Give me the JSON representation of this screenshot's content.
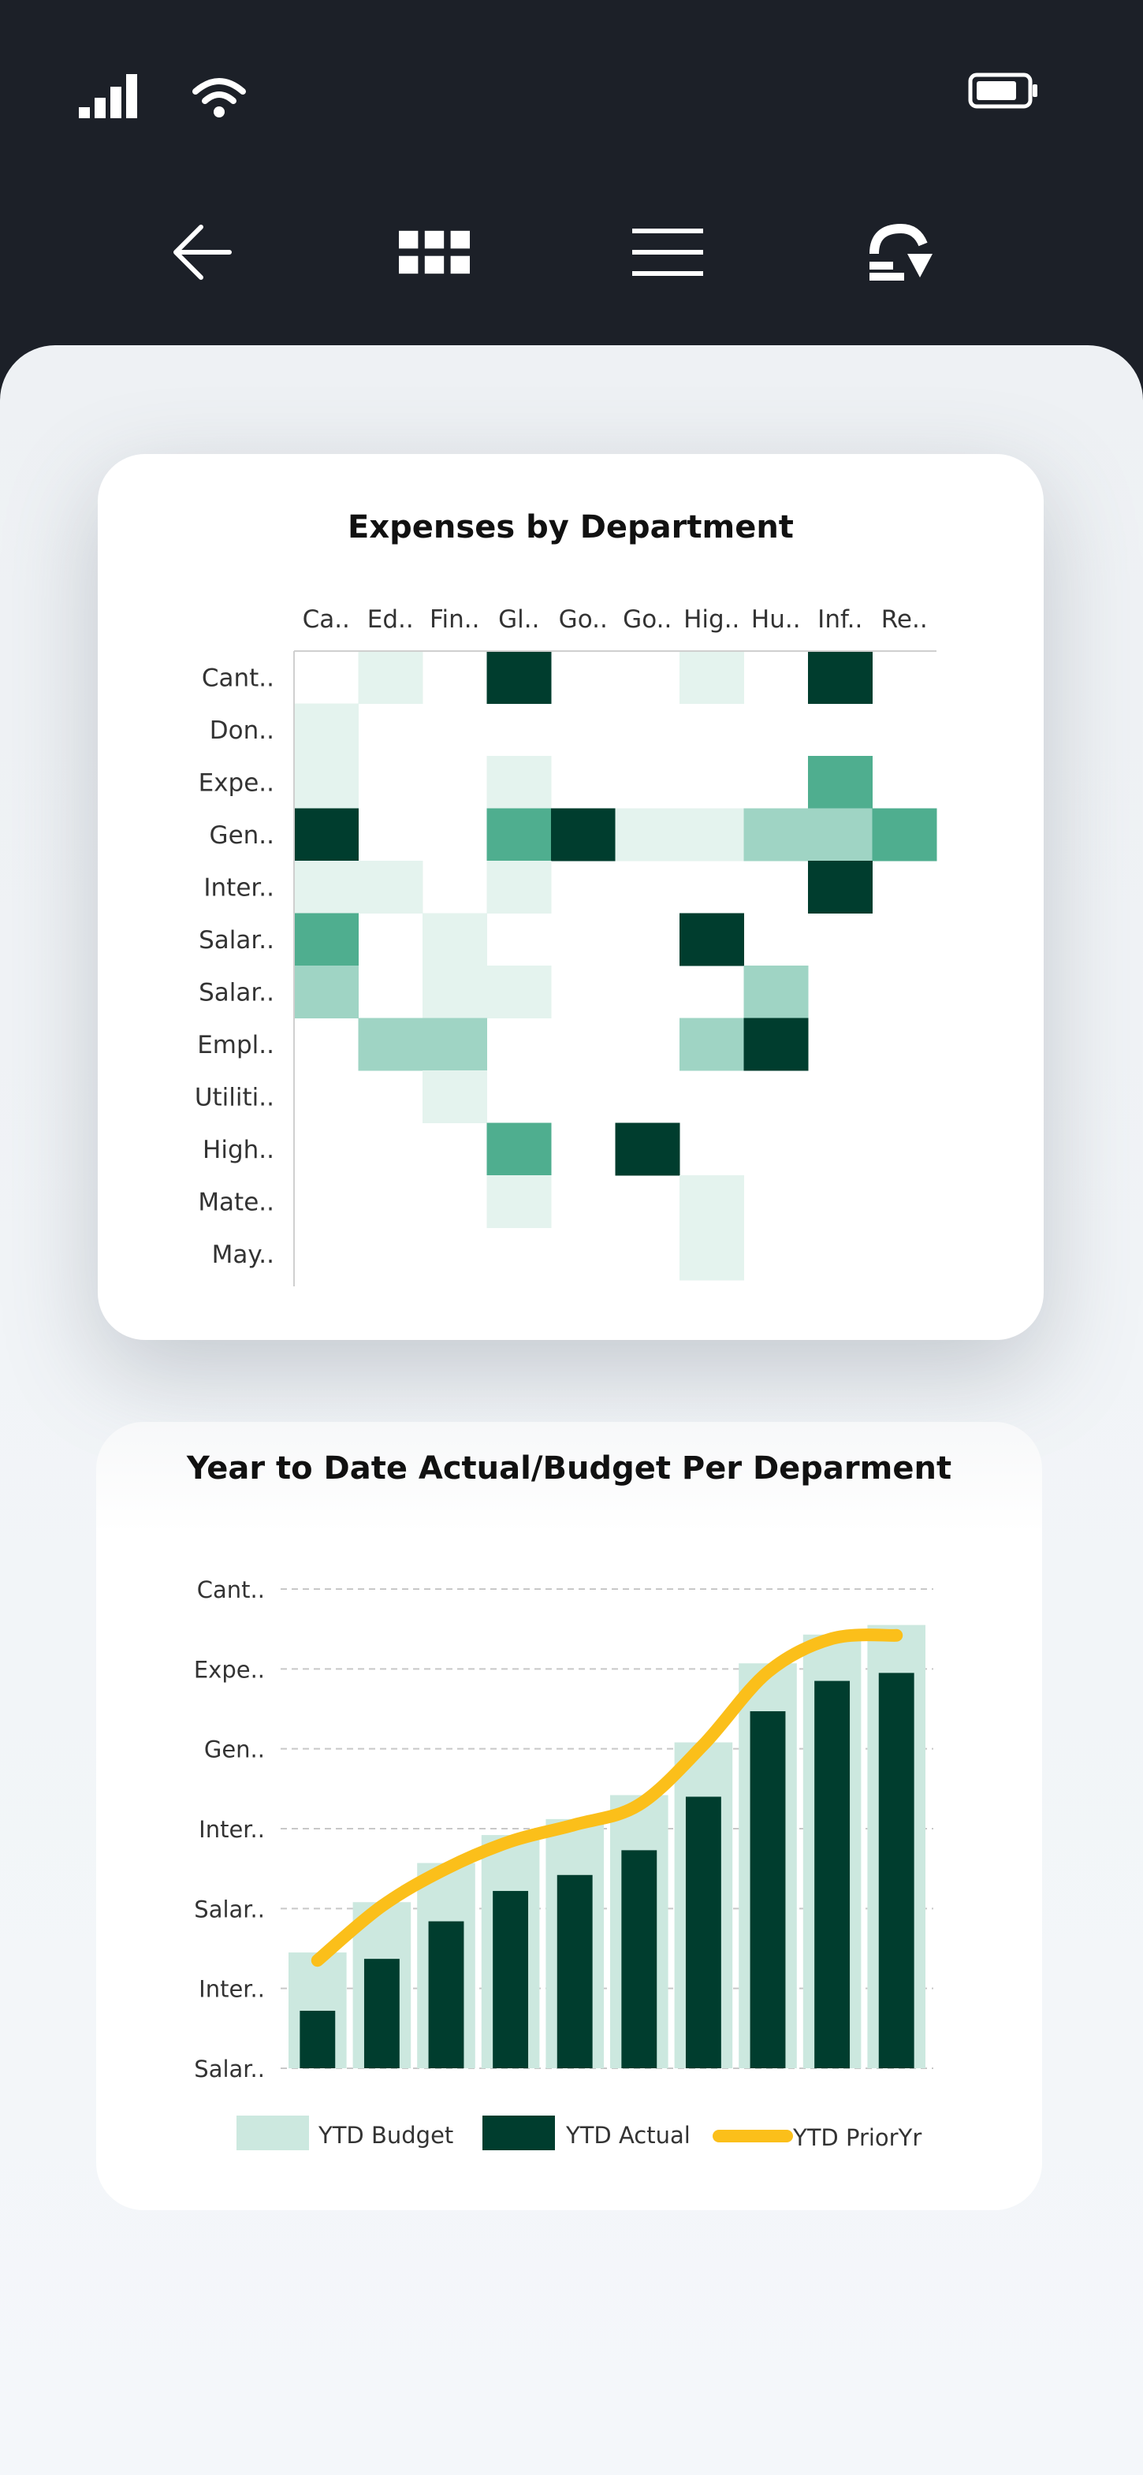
{
  "status_bar": {
    "signal_icon": "cellular-signal-icon",
    "wifi_icon": "wifi-icon",
    "battery_icon": "battery-icon"
  },
  "nav": {
    "icons": [
      "back-arrow-icon",
      "grid-icon",
      "menu-icon",
      "refresh-icon"
    ]
  },
  "colors": {
    "dark": "#003d2e",
    "mid": "#4fae8f",
    "light": "#9fd4c4",
    "pale": "#e4f3ee",
    "budget": "#cce8df",
    "prior_line": "#fbbf1a"
  },
  "chart_data": [
    {
      "type": "heatmap",
      "title": "Expenses by Department",
      "x_labels": [
        "Ca..",
        "Ed..",
        "Fin..",
        "Gl..",
        "Go..",
        "Go..",
        "Hig..",
        "Hu..",
        "Inf..",
        "Re.."
      ],
      "y_labels": [
        "Cant..",
        "Don..",
        "Expe..",
        "Gen..",
        "Inter..",
        "Salar..",
        "Salar..",
        "Empl..",
        "Utiliti..",
        "High..",
        "Mate..",
        "May.."
      ],
      "levels_legend": "0 = empty, 1 = pale, 2 = light, 3 = mid, 4 = dark",
      "cells": [
        [
          0,
          1,
          0,
          4,
          0,
          0,
          1,
          0,
          4,
          0
        ],
        [
          1,
          0,
          0,
          0,
          0,
          0,
          0,
          0,
          0,
          0
        ],
        [
          1,
          0,
          0,
          1,
          0,
          0,
          0,
          0,
          3,
          0
        ],
        [
          4,
          0,
          0,
          3,
          4,
          1,
          1,
          2,
          2,
          3
        ],
        [
          1,
          1,
          0,
          1,
          0,
          0,
          0,
          0,
          4,
          0
        ],
        [
          3,
          0,
          1,
          0,
          0,
          0,
          4,
          0,
          0,
          0
        ],
        [
          2,
          0,
          1,
          1,
          0,
          0,
          0,
          2,
          0,
          0
        ],
        [
          0,
          2,
          2,
          0,
          0,
          0,
          2,
          4,
          0,
          0
        ],
        [
          0,
          0,
          1,
          0,
          0,
          0,
          0,
          0,
          0,
          0
        ],
        [
          0,
          0,
          0,
          3,
          0,
          4,
          0,
          0,
          0,
          0
        ],
        [
          0,
          0,
          0,
          1,
          0,
          0,
          1,
          0,
          0,
          0
        ],
        [
          0,
          0,
          0,
          0,
          0,
          0,
          1,
          0,
          0,
          0
        ]
      ]
    },
    {
      "type": "bar",
      "title": "Year to Date Actual/Budget Per Deparment",
      "y_tick_labels": [
        "Cant..",
        "Expe..",
        "Gen..",
        "Inter..",
        "Salar..",
        "Inter..",
        "Salar.."
      ],
      "grid": true,
      "ylim": [
        0,
        6
      ],
      "series": [
        {
          "name": "YTD Budget",
          "values": [
            1.45,
            2.08,
            2.57,
            2.92,
            3.12,
            3.42,
            4.08,
            5.07,
            5.43,
            5.55
          ]
        },
        {
          "name": "YTD Actual",
          "values": [
            0.72,
            1.37,
            1.84,
            2.22,
            2.42,
            2.73,
            3.4,
            4.47,
            4.85,
            4.95
          ]
        },
        {
          "name": "YTD PriorYr",
          "values": [
            1.35,
            2.03,
            2.5,
            2.84,
            3.05,
            3.3,
            4.05,
            4.96,
            5.38,
            5.42
          ]
        }
      ],
      "legend_position": "bottom"
    }
  ]
}
